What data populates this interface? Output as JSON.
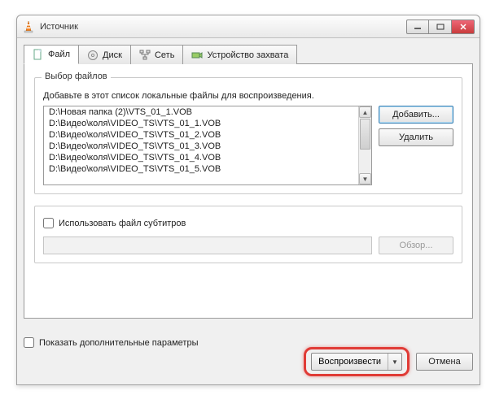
{
  "window": {
    "title": "Источник"
  },
  "tabs": {
    "file": "Файл",
    "disc": "Диск",
    "net": "Сеть",
    "capture": "Устройство захвата"
  },
  "fileSelection": {
    "legend": "Выбор файлов",
    "hint": "Добавьте в этот список локальные файлы для воспроизведения.",
    "items": [
      "D:\\Новая папка (2)\\VTS_01_1.VOB",
      "D:\\Видео\\коля\\VIDEO_TS\\VTS_01_1.VOB",
      "D:\\Видео\\коля\\VIDEO_TS\\VTS_01_2.VOB",
      "D:\\Видео\\коля\\VIDEO_TS\\VTS_01_3.VOB",
      "D:\\Видео\\коля\\VIDEO_TS\\VTS_01_4.VOB",
      "D:\\Видео\\коля\\VIDEO_TS\\VTS_01_5.VOB"
    ],
    "addLabel": "Добавить...",
    "removeLabel": "Удалить"
  },
  "subtitles": {
    "useLabel": "Использовать файл субтитров",
    "browseLabel": "Обзор..."
  },
  "moreOptions": {
    "label": "Показать дополнительные параметры"
  },
  "footer": {
    "playLabel": "Воспроизвести",
    "cancelLabel": "Отмена"
  }
}
